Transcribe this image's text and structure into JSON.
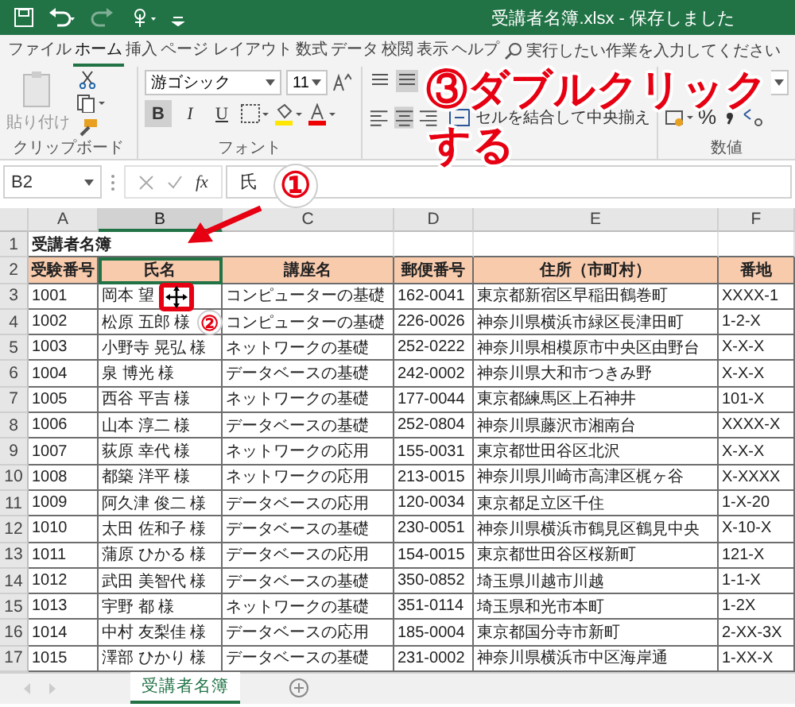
{
  "title_bar": {
    "title": "受講者名簿.xlsx  -  保存しました"
  },
  "ribbon_tabs": [
    {
      "label": "ファイル",
      "selected": false
    },
    {
      "label": "ホーム",
      "selected": true
    },
    {
      "label": "挿入",
      "selected": false
    },
    {
      "label": "ページ レイアウト",
      "selected": false
    },
    {
      "label": "数式",
      "selected": false
    },
    {
      "label": "データ",
      "selected": false
    },
    {
      "label": "校閲",
      "selected": false
    },
    {
      "label": "表示",
      "selected": false
    },
    {
      "label": "ヘルプ",
      "selected": false
    }
  ],
  "tell_me": {
    "placeholder": "実行したい作業を入力してください"
  },
  "ribbon": {
    "clipboard": {
      "paste_label": "貼り付け",
      "group_label": "クリップボード"
    },
    "font": {
      "font_name": "游ゴシック",
      "font_size": "11",
      "format_buttons": [
        "B",
        "I",
        "U"
      ],
      "group_label": "フォント"
    },
    "alignment": {
      "merge_label": "セルを結合して中央揃え"
    },
    "number": {
      "percent": "%",
      "group_label": "数値"
    }
  },
  "formula_bar": {
    "name_box": "B2",
    "function_label": "fx",
    "formula": "氏"
  },
  "columns": [
    {
      "label": "A",
      "selected": false
    },
    {
      "label": "B",
      "selected": true
    },
    {
      "label": "C",
      "selected": false
    },
    {
      "label": "D",
      "selected": false
    },
    {
      "label": "E",
      "selected": false
    },
    {
      "label": "F",
      "selected": false
    }
  ],
  "title_row": {
    "number": "1",
    "text": "受講者名簿"
  },
  "header_row": {
    "number": "2",
    "cells": [
      "受験番号",
      "氏名",
      "講座名",
      "郵便番号",
      "住所（市町村）",
      "番地"
    ]
  },
  "rows": [
    {
      "number": "3",
      "cells": [
        "1001",
        "岡本 望",
        "コンピューターの基礎",
        "162-0041",
        "東京都新宿区早稲田鶴巻町",
        "XXXX-1"
      ]
    },
    {
      "number": "4",
      "cells": [
        "1002",
        "松原 五郎 様",
        "コンピューターの基礎",
        "226-0026",
        "神奈川県横浜市緑区長津田町",
        "1-2-X"
      ]
    },
    {
      "number": "5",
      "cells": [
        "1003",
        "小野寺 晃弘 様",
        "ネットワークの基礎",
        "252-0222",
        "神奈川県相模原市中央区由野台",
        "X-X-X"
      ]
    },
    {
      "number": "6",
      "cells": [
        "1004",
        "泉 博光 様",
        "データベースの基礎",
        "242-0002",
        "神奈川県大和市つきみ野",
        "X-X-X"
      ]
    },
    {
      "number": "7",
      "cells": [
        "1005",
        "西谷 平吉 様",
        "ネットワークの基礎",
        "177-0044",
        "東京都練馬区上石神井",
        "101-X"
      ]
    },
    {
      "number": "8",
      "cells": [
        "1006",
        "山本 淳二 様",
        "データベースの基礎",
        "252-0804",
        "神奈川県藤沢市湘南台",
        "XXXX-X"
      ]
    },
    {
      "number": "9",
      "cells": [
        "1007",
        "荻原 幸代 様",
        "ネットワークの応用",
        "155-0031",
        "東京都世田谷区北沢",
        "X-X-X"
      ]
    },
    {
      "number": "10",
      "cells": [
        "1008",
        "都築 洋平 様",
        "ネットワークの応用",
        "213-0015",
        "神奈川県川崎市高津区梶ヶ谷",
        "X-XXXX"
      ]
    },
    {
      "number": "11",
      "cells": [
        "1009",
        "阿久津 俊二 様",
        "データベースの応用",
        "120-0034",
        "東京都足立区千住",
        "1-X-20"
      ]
    },
    {
      "number": "12",
      "cells": [
        "1010",
        "太田 佐和子 様",
        "データベースの基礎",
        "230-0051",
        "神奈川県横浜市鶴見区鶴見中央",
        "X-10-X"
      ]
    },
    {
      "number": "13",
      "cells": [
        "1011",
        "蒲原 ひかる 様",
        "データベースの応用",
        "154-0015",
        "東京都世田谷区桜新町",
        "121-X"
      ]
    },
    {
      "number": "14",
      "cells": [
        "1012",
        "武田 美智代 様",
        "データベースの基礎",
        "350-0852",
        "埼玉県川越市川越",
        "1-1-X"
      ]
    },
    {
      "number": "15",
      "cells": [
        "1013",
        "宇野 都 様",
        "ネットワークの基礎",
        "351-0114",
        "埼玉県和光市本町",
        "1-2X"
      ]
    },
    {
      "number": "16",
      "cells": [
        "1014",
        "中村 友梨佳 様",
        "データベースの応用",
        "185-0004",
        "東京都国分寺市新町",
        "2-XX-3X"
      ]
    },
    {
      "number": "17",
      "cells": [
        "1015",
        "澤部 ひかり 様",
        "データベースの基礎",
        "231-0002",
        "神奈川県横浜市中区海岸通",
        "1-XX-X"
      ]
    }
  ],
  "sheet_tabs": [
    {
      "label": "受講者名簿",
      "selected": true
    }
  ],
  "annotations": [
    {
      "kind": "step",
      "text": "①"
    },
    {
      "kind": "step",
      "text": "②"
    },
    {
      "kind": "headline",
      "text": "③ダブルクリック"
    },
    {
      "kind": "headline",
      "text": "する"
    }
  ]
}
